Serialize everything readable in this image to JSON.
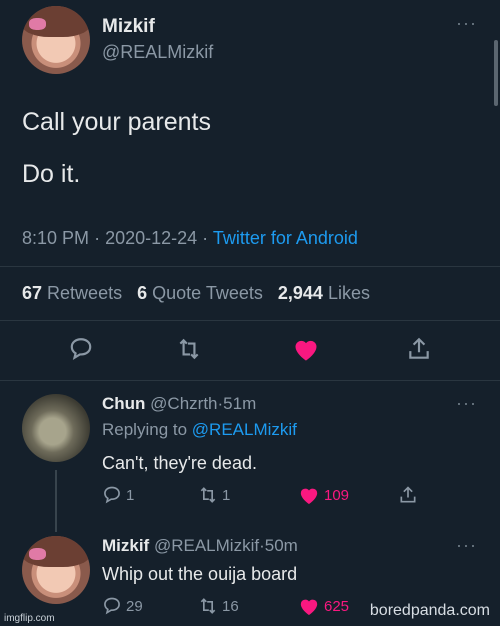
{
  "tweet": {
    "display_name": "Mizkif",
    "handle": "@REALMizkif",
    "text_line_1": "Call your parents",
    "text_line_2": "Do it.",
    "time": "8:10 PM",
    "date": "2020-12-24",
    "source": "Twitter for Android",
    "separator": "·",
    "retweets_count": "67",
    "retweets_label": "Retweets",
    "quotes_count": "6",
    "quotes_label": "Quote Tweets",
    "likes_count": "2,944",
    "likes_label": "Likes"
  },
  "replies": [
    {
      "display_name": "Chun",
      "handle": "@Chzrth",
      "time": "51m",
      "replying_prefix": "Replying to",
      "replying_to": "@REALMizkif",
      "text": "Can't, they're dead.",
      "reply_count": "1",
      "retweet_count": "1",
      "like_count": "109"
    },
    {
      "display_name": "Mizkif",
      "handle": "@REALMizkif",
      "time": "50m",
      "text": "Whip out the ouija board",
      "reply_count": "29",
      "retweet_count": "16",
      "like_count": "625"
    }
  ],
  "watermarks": {
    "left": "imgflip.com",
    "right": "boredpanda.com"
  },
  "icons": [
    "more-icon",
    "reply-icon",
    "retweet-icon",
    "heart-icon",
    "share-icon"
  ],
  "colors": {
    "background": "#15202b",
    "link": "#1d9bf0",
    "like": "#f91880",
    "muted": "#8b98a5"
  }
}
